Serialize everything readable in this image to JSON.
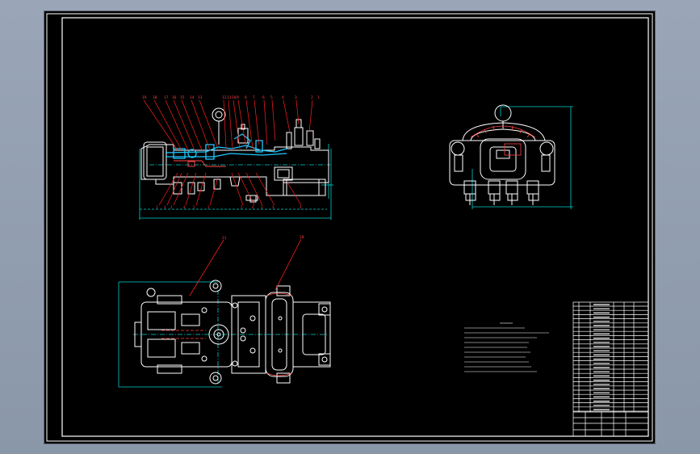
{
  "app": {
    "view_background": "#8d9aab",
    "paper_color": "#000000"
  },
  "colors": {
    "border": "#ffffff",
    "geometry": "#ffffff",
    "dimension": "#00d0d0",
    "leader": "#ff2020",
    "highlight": "#20c8ff"
  },
  "views": {
    "front": {
      "name": "front-view"
    },
    "side": {
      "name": "side-view"
    },
    "top": {
      "name": "top-view"
    }
  },
  "balloons_front": [
    "19",
    "18",
    "17",
    "16",
    "15",
    "14",
    "13",
    "12",
    "11",
    "10",
    "9",
    "8",
    "7",
    "6",
    "5",
    "4",
    "3",
    "2",
    "1"
  ],
  "balloons_top": [
    "21",
    "20"
  ]
}
